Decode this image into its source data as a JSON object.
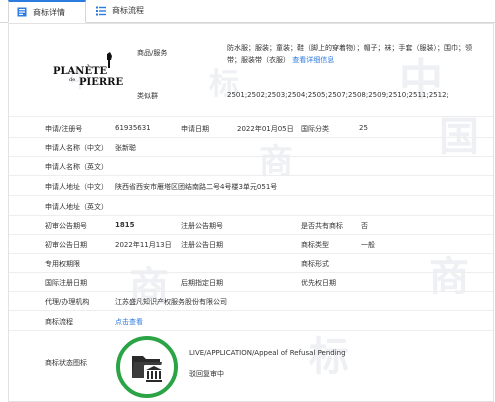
{
  "tabs": [
    {
      "label": "商标详情",
      "icon": "trademark-detail-icon"
    },
    {
      "label": "商标流程",
      "icon": "list-icon"
    }
  ],
  "logo": {
    "line1": "PLANÈTE",
    "line2": "de",
    "line3": "PIERRE"
  },
  "goods": {
    "label": "商品/服务",
    "value": "防水服；服装；童装；鞋（脚上的穿着物）；帽子；袜；手套（服装）；围巾；领带；服装带（衣服）",
    "link": "查看详细信息"
  },
  "similar": {
    "label": "类似群",
    "value": "2501;2502;2503;2504;2505;2507;2508;2509;2510;2511;2512;"
  },
  "fields": {
    "reg_no_label": "申请/注册号",
    "reg_no": "61935631",
    "apply_date_label": "申请日期",
    "apply_date": "2022年01月05日",
    "class_label": "国际分类",
    "class": "25",
    "name_cn_label": "申请人名称（中文）",
    "name_cn": "张新聪",
    "name_en_label": "申请人名称（英文）",
    "addr_cn_label": "申请人地址（中文）",
    "addr_cn": "陕西省西安市雁塔区团结南路二号4号楼3单元051号",
    "addr_en_label": "申请人地址（英文）",
    "pub_no_label": "初审公告期号",
    "pub_no": "1815",
    "reg_pub_no_label": "注册公告期号",
    "shared_label": "是否共有商标",
    "shared": "否",
    "pub_date_label": "初审公告日期",
    "pub_date": "2022年11月13日",
    "reg_pub_date_label": "注册公告日期",
    "type_label": "商标类型",
    "type": "一般",
    "exclusive_label": "专用权期限",
    "form_label": "商标形式",
    "intl_reg_label": "国际注册日期",
    "later_label": "后期指定日期",
    "priority_label": "优先权日期",
    "agent_label": "代理/办理机构",
    "agent": "江苏盛凡知识产权服务股份有限公司",
    "flow_label": "商标流程",
    "flow_link": "点击查看",
    "status_label": "商标状态图标"
  },
  "status": {
    "en": "LIVE/APPLICATION/Appeal of Refusal Pending",
    "cn": "驳回复审中",
    "color": "#2aa445",
    "icon": "folder-court-icon"
  },
  "watermark": [
    "中",
    "商",
    "标",
    "中",
    "国",
    "商"
  ]
}
